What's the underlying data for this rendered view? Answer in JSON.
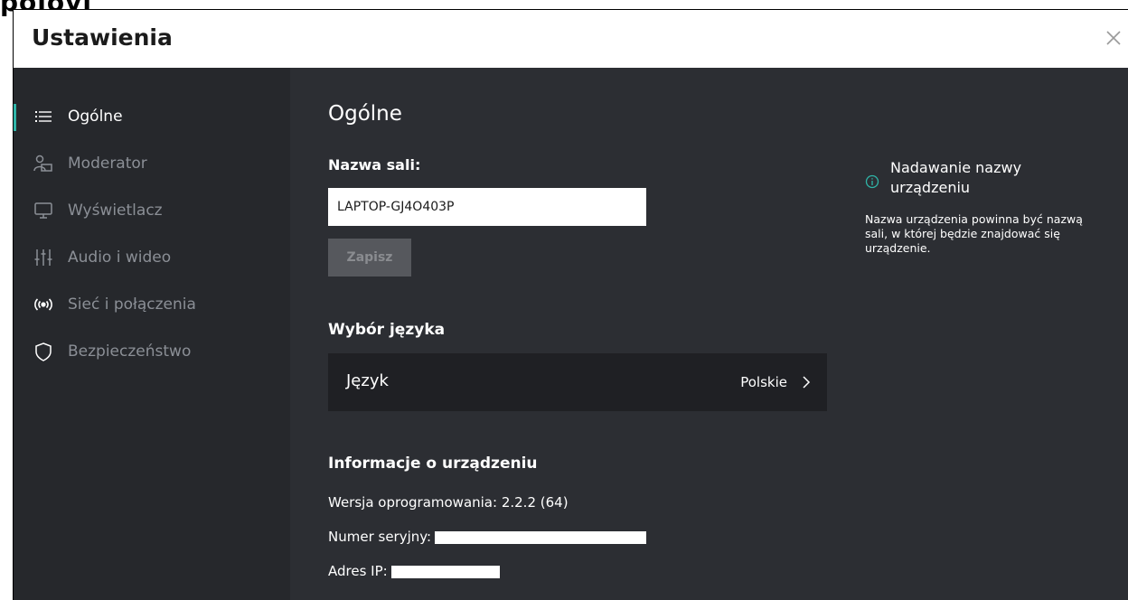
{
  "header": {
    "fragment": "polovi",
    "title": "Ustawienia"
  },
  "sidebar": {
    "items": [
      {
        "label": "Ogólne",
        "icon": "list-icon",
        "active": true
      },
      {
        "label": "Moderator",
        "icon": "moderator-icon",
        "active": false
      },
      {
        "label": "Wyświetlacz",
        "icon": "monitor-icon",
        "active": false
      },
      {
        "label": "Audio i wideo",
        "icon": "sliders-icon",
        "active": false
      },
      {
        "label": "Sieć i połączenia",
        "icon": "broadcast-icon",
        "active": false
      },
      {
        "label": "Bezpieczeństwo",
        "icon": "shield-icon",
        "active": false
      }
    ]
  },
  "main": {
    "heading": "Ogólne",
    "room_name_label": "Nazwa sali:",
    "room_name_value": "LAPTOP-GJ4O403P",
    "save_label": "Zapisz",
    "language_section_title": "Wybór języka",
    "language_label": "Język",
    "language_value": "Polskie",
    "device_info_title": "Informacje o urządzeniu",
    "software_version": "Wersja oprogramowania: 2.2.2 (64)",
    "serial_label": "Numer seryjny:",
    "ip_label": "Adres IP:"
  },
  "help": {
    "title": "Nadawanie nazwy urządzeniu",
    "text": "Nazwa urządzenia powinna być nazwą sali, w której będzie znajdować się urządzenie."
  },
  "colors": {
    "accent": "#2fb5a8",
    "sidebar_bg": "#26282c",
    "main_bg": "#2c2e33"
  }
}
